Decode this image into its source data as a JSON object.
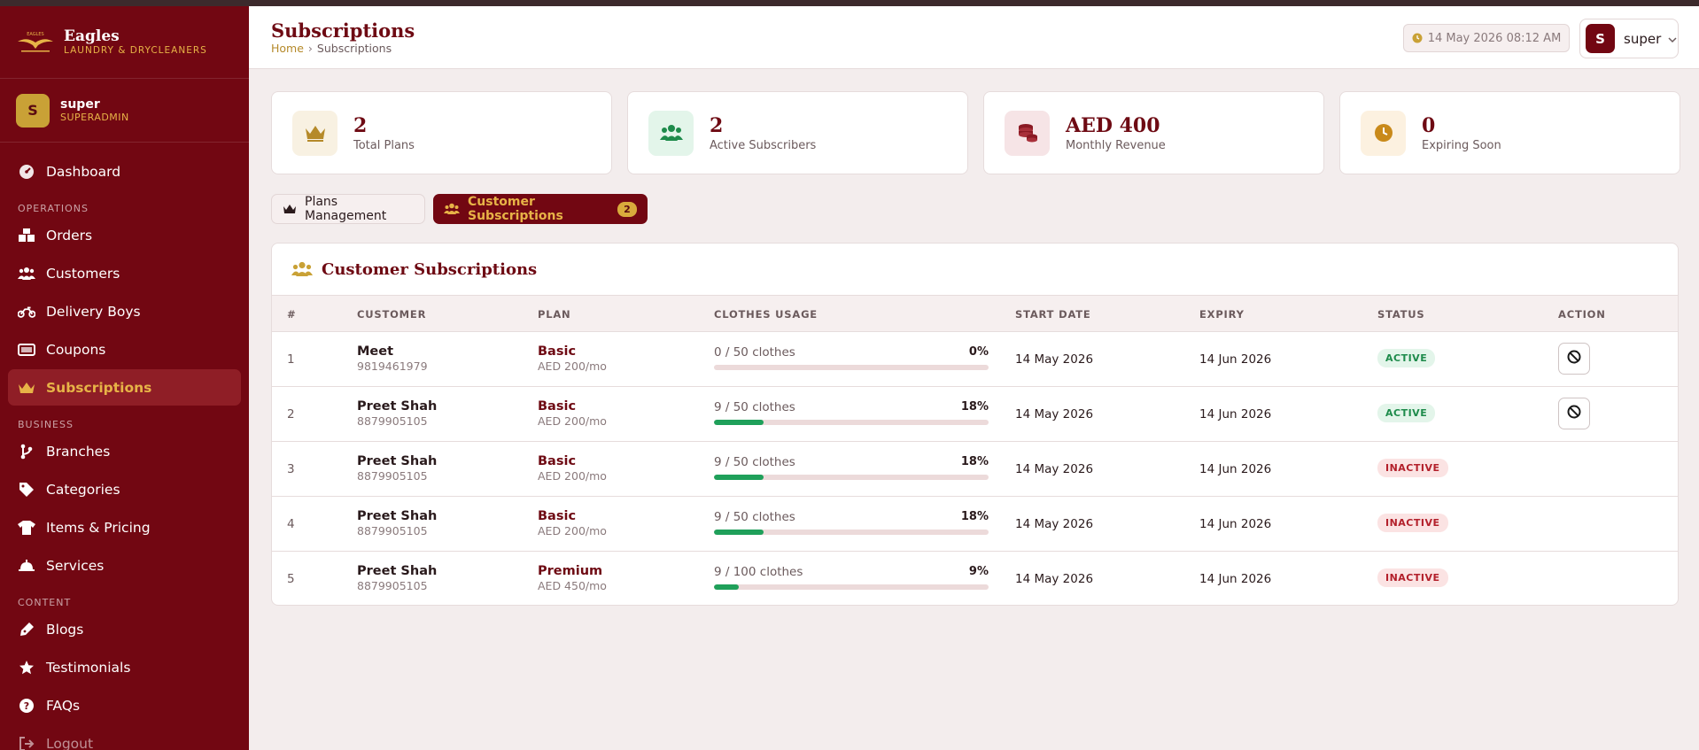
{
  "app": {
    "name": "Eagles",
    "subtitle": "LAUNDRY & DRYCLEANERS",
    "logo_text": "EAGLES"
  },
  "sidebar": {
    "user": {
      "initial": "S",
      "name": "super",
      "role": "SUPERADMIN"
    },
    "dashboard": "Dashboard",
    "sections": {
      "operations": "OPERATIONS",
      "business": "BUSINESS",
      "content": "CONTENT"
    },
    "items": {
      "orders": "Orders",
      "customers": "Customers",
      "delivery_boys": "Delivery Boys",
      "coupons": "Coupons",
      "subscriptions": "Subscriptions",
      "branches": "Branches",
      "categories": "Categories",
      "items_pricing": "Items & Pricing",
      "services": "Services",
      "blogs": "Blogs",
      "testimonials": "Testimonials",
      "faqs": "FAQs",
      "logout": "Logout"
    }
  },
  "header": {
    "title": "Subscriptions",
    "breadcrumb": {
      "home": "Home",
      "current": "Subscriptions"
    },
    "datetime": "14 May 2026 08:12 AM",
    "user": {
      "initial": "S",
      "name": "super"
    }
  },
  "stats": [
    {
      "value": "2",
      "label": "Total Plans",
      "icon": "crown-icon",
      "color": "#b58a2a"
    },
    {
      "value": "2",
      "label": "Active Subscribers",
      "icon": "users-icon",
      "color": "#1e8b4b"
    },
    {
      "value": "AED 400",
      "label": "Monthly Revenue",
      "icon": "coins-icon",
      "color": "#8a1a24"
    },
    {
      "value": "0",
      "label": "Expiring Soon",
      "icon": "clock-icon",
      "color": "#c98a1a"
    }
  ],
  "tabs": {
    "plans": "Plans Management",
    "subscriptions": "Customer Subscriptions",
    "subscriptions_count": "2"
  },
  "table": {
    "title": "Customer Subscriptions",
    "columns": {
      "num": "#",
      "customer": "CUSTOMER",
      "plan": "PLAN",
      "usage": "CLOTHES USAGE",
      "start": "START DATE",
      "expiry": "EXPIRY",
      "status": "STATUS",
      "action": "ACTION"
    },
    "rows": [
      {
        "num": "1",
        "name": "Meet",
        "phone": "9819461979",
        "plan": "Basic",
        "price": "AED 200/mo",
        "usage": "0 / 50 clothes",
        "pct": "0%",
        "fill": 0,
        "start": "14 May 2026",
        "expiry": "14 Jun 2026",
        "status": "ACTIVE",
        "status_type": "active",
        "action": true
      },
      {
        "num": "2",
        "name": "Preet Shah",
        "phone": "8879905105",
        "plan": "Basic",
        "price": "AED 200/mo",
        "usage": "9 / 50 clothes",
        "pct": "18%",
        "fill": 18,
        "start": "14 May 2026",
        "expiry": "14 Jun 2026",
        "status": "ACTIVE",
        "status_type": "active",
        "action": true
      },
      {
        "num": "3",
        "name": "Preet Shah",
        "phone": "8879905105",
        "plan": "Basic",
        "price": "AED 200/mo",
        "usage": "9 / 50 clothes",
        "pct": "18%",
        "fill": 18,
        "start": "14 May 2026",
        "expiry": "14 Jun 2026",
        "status": "INACTIVE",
        "status_type": "inactive",
        "action": false
      },
      {
        "num": "4",
        "name": "Preet Shah",
        "phone": "8879905105",
        "plan": "Basic",
        "price": "AED 200/mo",
        "usage": "9 / 50 clothes",
        "pct": "18%",
        "fill": 18,
        "start": "14 May 2026",
        "expiry": "14 Jun 2026",
        "status": "INACTIVE",
        "status_type": "inactive",
        "action": false
      },
      {
        "num": "5",
        "name": "Preet Shah",
        "phone": "8879905105",
        "plan": "Premium",
        "price": "AED 450/mo",
        "usage": "9 / 100 clothes",
        "pct": "9%",
        "fill": 9,
        "start": "14 May 2026",
        "expiry": "14 Jun 2026",
        "status": "INACTIVE",
        "status_type": "inactive",
        "action": false
      }
    ]
  },
  "colors": {
    "sidebar": "#720712",
    "accent": "#e7b347",
    "progress": "#1fa05a"
  }
}
